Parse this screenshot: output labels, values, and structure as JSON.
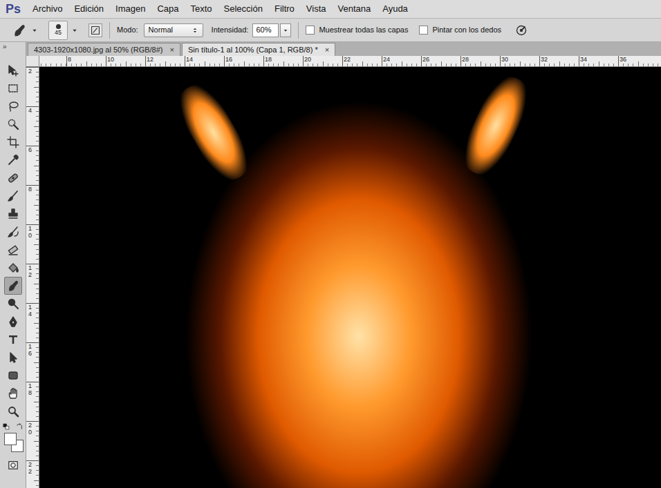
{
  "window": {
    "app_logo": "Ps"
  },
  "menu": {
    "items": [
      "Archivo",
      "Edición",
      "Imagen",
      "Capa",
      "Texto",
      "Selección",
      "Filtro",
      "Vista",
      "Ventana",
      "Ayuda"
    ]
  },
  "options_bar": {
    "brush_size": "45",
    "mode_label": "Modo:",
    "mode": "Normal",
    "intensity_label": "Intensidad:",
    "intensity": "60%",
    "checkboxes": [
      {
        "label": "Muestrear todas las capas",
        "checked": false
      },
      {
        "label": "Pintar con los dedos",
        "checked": false
      }
    ]
  },
  "tabs": [
    {
      "label": "4303-1920x1080.jpg al 50% (RGB/8#)",
      "close": "×",
      "selected": false
    },
    {
      "label": "Sin título-1 al 100% (Capa 1, RGB/8) *",
      "close": "×",
      "selected": true
    }
  ],
  "toolbar": {
    "collapse": "»",
    "tools": [
      {
        "kind": "move",
        "selected": false
      },
      {
        "kind": "marquee",
        "selected": false
      },
      {
        "kind": "lasso",
        "selected": false
      },
      {
        "kind": "quickselect",
        "selected": false
      },
      {
        "kind": "crop",
        "selected": false
      },
      {
        "kind": "eyedropper",
        "selected": false
      },
      {
        "kind": "healing",
        "selected": false
      },
      {
        "kind": "brush",
        "selected": false
      },
      {
        "kind": "stamp",
        "selected": false
      },
      {
        "kind": "historybrush",
        "selected": false
      },
      {
        "kind": "eraser",
        "selected": false
      },
      {
        "kind": "bucket",
        "selected": false
      },
      {
        "kind": "smudge",
        "selected": true
      },
      {
        "kind": "dodge",
        "selected": false
      },
      {
        "kind": "pen",
        "selected": false
      },
      {
        "kind": "type",
        "selected": false
      },
      {
        "kind": "pathselect",
        "selected": false
      },
      {
        "kind": "shape",
        "selected": false
      },
      {
        "kind": "hand",
        "selected": false
      },
      {
        "kind": "zoom",
        "selected": false
      }
    ]
  },
  "swatches": {
    "foreground": "#ffffff",
    "background": "#ffffff"
  },
  "rulers": {
    "horizontal": [
      "8",
      "10",
      "12",
      "14",
      "16",
      "18",
      "20",
      "22",
      "24",
      "26",
      "28",
      "30",
      "32",
      "34",
      "36"
    ],
    "vertical": [
      "2",
      "4",
      "6",
      "8",
      "10",
      "12",
      "14",
      "16",
      "18",
      "20",
      "22"
    ]
  }
}
